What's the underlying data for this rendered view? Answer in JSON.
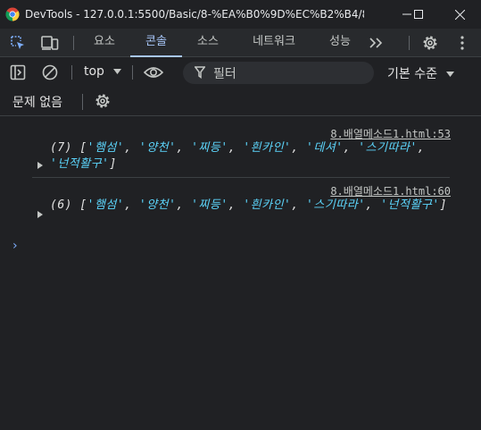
{
  "window": {
    "title": "DevTools - 127.0.0.1:5500/Basic/8-%EA%B0%9D%EC%B2%B4/8.%E..."
  },
  "tabs": [
    {
      "label": "요소",
      "active": false
    },
    {
      "label": "콘솔",
      "active": true
    },
    {
      "label": "소스",
      "active": false
    },
    {
      "label": "네트워크",
      "active": false
    },
    {
      "label": "성능",
      "active": false
    }
  ],
  "toolbar": {
    "context": "top",
    "filter_placeholder": "필터",
    "level": "기본 수준"
  },
  "issues": {
    "label": "문제 없음"
  },
  "messages": [
    {
      "source": "8.배열메소드1.html:53",
      "prefix": "(7) [",
      "items": [
        "'햄섬'",
        "'양천'",
        "'찌등'",
        "'흰카인'",
        "'데셔'",
        "'스기따라'",
        "'넌적활구'"
      ],
      "suffix": "]"
    },
    {
      "source": "8.배열메소드1.html:60",
      "prefix": "(6) [",
      "items": [
        "'햄섬'",
        "'양천'",
        "'찌등'",
        "'흰카인'",
        "'스기따라'",
        "'넌적활구'"
      ],
      "suffix": "]"
    }
  ],
  "prompt_symbol": "›",
  "colors": {
    "background": "#202124",
    "accent": "#a8c7fa",
    "string": "#5cd5fb"
  },
  "icons": [
    "chrome-logo-icon",
    "minimize-icon",
    "maximize-icon",
    "close-icon",
    "inspect-element-icon",
    "device-toolbar-icon",
    "more-tabs-icon",
    "settings-gear-icon",
    "more-vert-icon",
    "sidebar-toggle-icon",
    "clear-console-icon",
    "dropdown-caret-icon",
    "eye-icon",
    "filter-funnel-icon",
    "issues-settings-gear-icon"
  ]
}
